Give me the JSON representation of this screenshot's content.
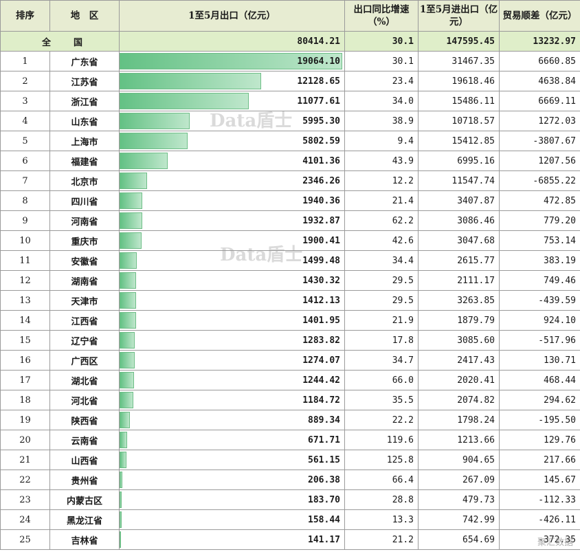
{
  "headers": {
    "rank": "排序",
    "region": "地　区",
    "export": "1至5月出口（亿元）",
    "growth": "出口同比增速（%）",
    "import": "1至5月进出口（亿元）",
    "surplus": "贸易顺差（亿元）"
  },
  "national": {
    "label": "全　国",
    "export": "80414.21",
    "growth": "30.1",
    "import": "147595.45",
    "surplus": "13232.97"
  },
  "rows": [
    {
      "rank": "1",
      "region": "广东省",
      "export": "19064.10",
      "growth": "30.1",
      "import": "31467.35",
      "surplus": "6660.85",
      "export_value": 19064.1
    },
    {
      "rank": "2",
      "region": "江苏省",
      "export": "12128.65",
      "growth": "23.4",
      "import": "19618.46",
      "surplus": "4638.84",
      "export_value": 12128.65
    },
    {
      "rank": "3",
      "region": "浙江省",
      "export": "11077.61",
      "growth": "34.0",
      "import": "15486.11",
      "surplus": "6669.11",
      "export_value": 11077.61
    },
    {
      "rank": "4",
      "region": "山东省",
      "export": "5995.30",
      "growth": "38.9",
      "import": "10718.57",
      "surplus": "1272.03",
      "export_value": 5995.3
    },
    {
      "rank": "5",
      "region": "上海市",
      "export": "5802.59",
      "growth": "9.4",
      "import": "15412.85",
      "surplus": "-3807.67",
      "export_value": 5802.59
    },
    {
      "rank": "6",
      "region": "福建省",
      "export": "4101.36",
      "growth": "43.9",
      "import": "6995.16",
      "surplus": "1207.56",
      "export_value": 4101.36
    },
    {
      "rank": "7",
      "region": "北京市",
      "export": "2346.26",
      "growth": "12.2",
      "import": "11547.74",
      "surplus": "-6855.22",
      "export_value": 2346.26
    },
    {
      "rank": "8",
      "region": "四川省",
      "export": "1940.36",
      "growth": "21.4",
      "import": "3407.87",
      "surplus": "472.85",
      "export_value": 1940.36
    },
    {
      "rank": "9",
      "region": "河南省",
      "export": "1932.87",
      "growth": "62.2",
      "import": "3086.46",
      "surplus": "779.20",
      "export_value": 1932.87
    },
    {
      "rank": "10",
      "region": "重庆市",
      "export": "1900.41",
      "growth": "42.6",
      "import": "3047.68",
      "surplus": "753.14",
      "export_value": 1900.41
    },
    {
      "rank": "11",
      "region": "安徽省",
      "export": "1499.48",
      "growth": "34.4",
      "import": "2615.77",
      "surplus": "383.19",
      "export_value": 1499.48
    },
    {
      "rank": "12",
      "region": "湖南省",
      "export": "1430.32",
      "growth": "29.5",
      "import": "2111.17",
      "surplus": "749.46",
      "export_value": 1430.32
    },
    {
      "rank": "13",
      "region": "天津市",
      "export": "1412.13",
      "growth": "29.5",
      "import": "3263.85",
      "surplus": "-439.59",
      "export_value": 1412.13
    },
    {
      "rank": "14",
      "region": "江西省",
      "export": "1401.95",
      "growth": "21.9",
      "import": "1879.79",
      "surplus": "924.10",
      "export_value": 1401.95
    },
    {
      "rank": "15",
      "region": "辽宁省",
      "export": "1283.82",
      "growth": "17.8",
      "import": "3085.60",
      "surplus": "-517.96",
      "export_value": 1283.82
    },
    {
      "rank": "16",
      "region": "广西区",
      "export": "1274.07",
      "growth": "34.7",
      "import": "2417.43",
      "surplus": "130.71",
      "export_value": 1274.07
    },
    {
      "rank": "17",
      "region": "湖北省",
      "export": "1244.42",
      "growth": "66.0",
      "import": "2020.41",
      "surplus": "468.44",
      "export_value": 1244.42
    },
    {
      "rank": "18",
      "region": "河北省",
      "export": "1184.72",
      "growth": "35.5",
      "import": "2074.82",
      "surplus": "294.62",
      "export_value": 1184.72
    },
    {
      "rank": "19",
      "region": "陕西省",
      "export": "889.34",
      "growth": "22.2",
      "import": "1798.24",
      "surplus": "-195.50",
      "export_value": 889.34
    },
    {
      "rank": "20",
      "region": "云南省",
      "export": "671.71",
      "growth": "119.6",
      "import": "1213.66",
      "surplus": "129.76",
      "export_value": 671.71
    },
    {
      "rank": "21",
      "region": "山西省",
      "export": "561.15",
      "growth": "125.8",
      "import": "904.65",
      "surplus": "217.66",
      "export_value": 561.15
    },
    {
      "rank": "22",
      "region": "贵州省",
      "export": "206.38",
      "growth": "66.4",
      "import": "267.09",
      "surplus": "145.67",
      "export_value": 206.38
    },
    {
      "rank": "23",
      "region": "内蒙古区",
      "export": "183.70",
      "growth": "28.8",
      "import": "479.73",
      "surplus": "-112.33",
      "export_value": 183.7
    },
    {
      "rank": "24",
      "region": "黑龙江省",
      "export": "158.44",
      "growth": "13.3",
      "import": "742.99",
      "surplus": "-426.11",
      "export_value": 158.44
    },
    {
      "rank": "25",
      "region": "吉林省",
      "export": "141.17",
      "growth": "21.2",
      "import": "654.69",
      "surplus": "-372.35",
      "export_value": 141.17
    }
  ],
  "bar_max": 19064.1,
  "watermark": "Data盾士",
  "logo_text": "聚汇数据",
  "colors": {
    "bar_start": "#63c184",
    "bar_end": "#bfe7cc",
    "header_bg": "#e7ecd2",
    "national_bg": "#dfeec9"
  }
}
